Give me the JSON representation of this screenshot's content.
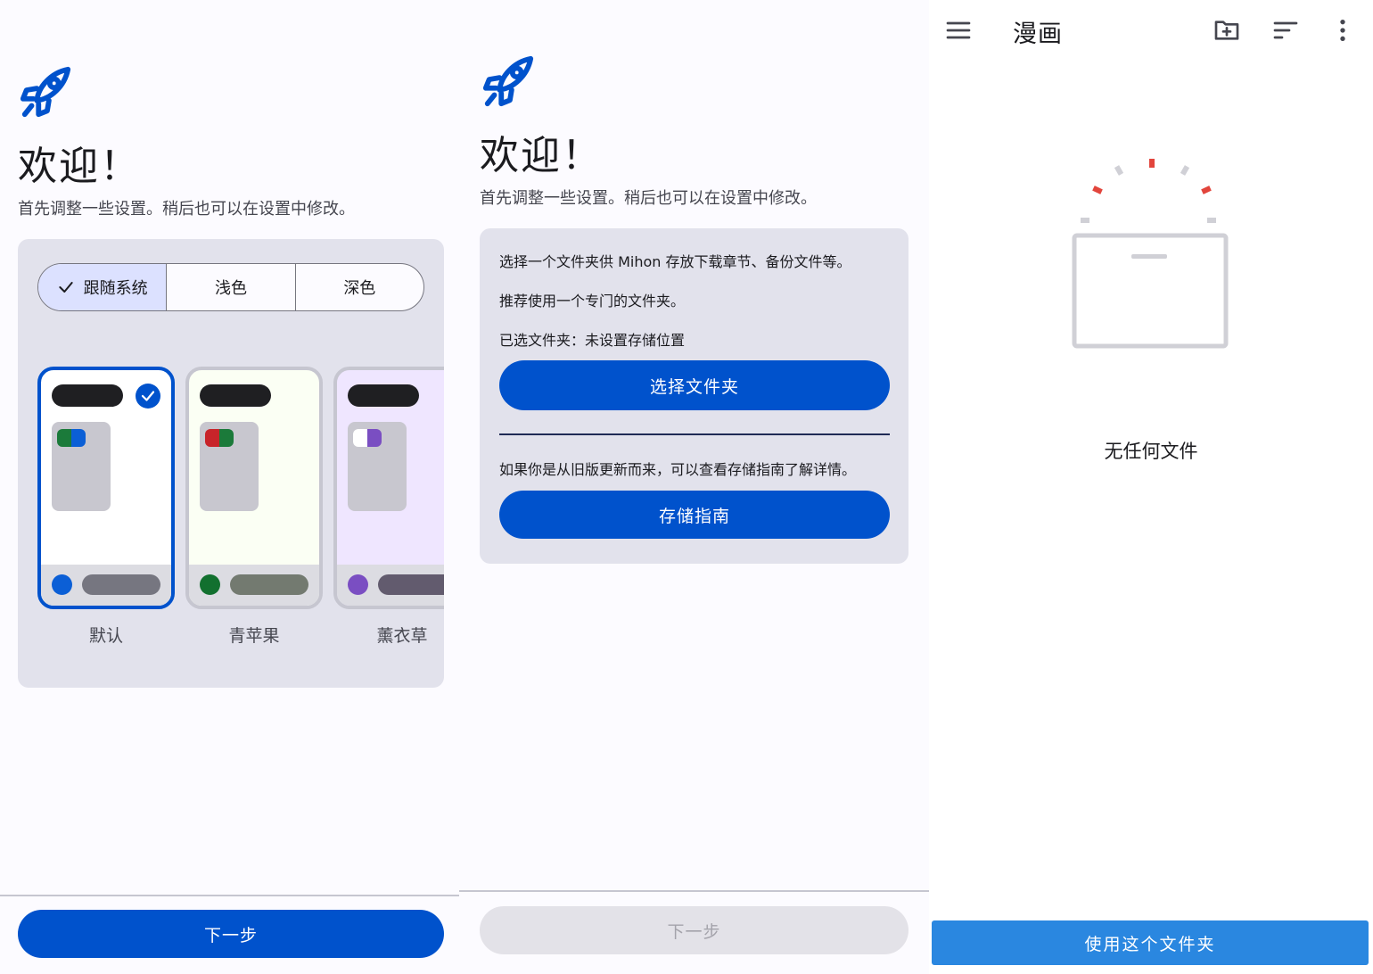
{
  "panel1": {
    "title": "欢迎！",
    "subtitle": "首先调整一些设置。稍后也可以在设置中修改。",
    "theme_modes": [
      {
        "label": "跟随系统",
        "selected": true
      },
      {
        "label": "浅色",
        "selected": false
      },
      {
        "label": "深色",
        "selected": false
      }
    ],
    "themes": [
      {
        "label": "默认",
        "selected": true,
        "bg": "#ffffff",
        "chip": [
          "#1b7a3a",
          "#0b5fd6"
        ],
        "dot": "#0b5fd6",
        "pill": "#767680"
      },
      {
        "label": "青苹果",
        "selected": false,
        "bg": "#fbfff4",
        "chip": [
          "#c8242a",
          "#1b7a3a"
        ],
        "dot": "#12702f",
        "pill": "#737a70"
      },
      {
        "label": "薰衣草",
        "selected": false,
        "bg": "#efe6ff",
        "chip": [
          "#ffffff",
          "#7a4ec2"
        ],
        "dot": "#7a4ec2",
        "pill": "#625b6e"
      }
    ],
    "next_label": "下一步"
  },
  "panel2": {
    "title": "欢迎！",
    "subtitle": "首先调整一些设置。稍后也可以在设置中修改。",
    "line1": "选择一个文件夹供 Mihon 存放下载章节、备份文件等。",
    "line2": "推荐使用一个专门的文件夹。",
    "line3": "已选文件夹：未设置存储位置",
    "choose_folder_label": "选择文件夹",
    "line4": "如果你是从旧版更新而来，可以查看存储指南了解详情。",
    "storage_guide_label": "存储指南",
    "next_label": "下一步"
  },
  "panel3": {
    "toolbar_title": "漫画",
    "empty_text": "无任何文件",
    "use_folder_label": "使用这个文件夹",
    "icons": [
      "menu-icon",
      "new-folder-icon",
      "sort-icon",
      "more-vert-icon"
    ]
  },
  "colors": {
    "accent": "#0052cc",
    "wide_button": "#2a87e0",
    "card_bg": "#e2e2ec",
    "empty_sparks": "#e2453c"
  }
}
